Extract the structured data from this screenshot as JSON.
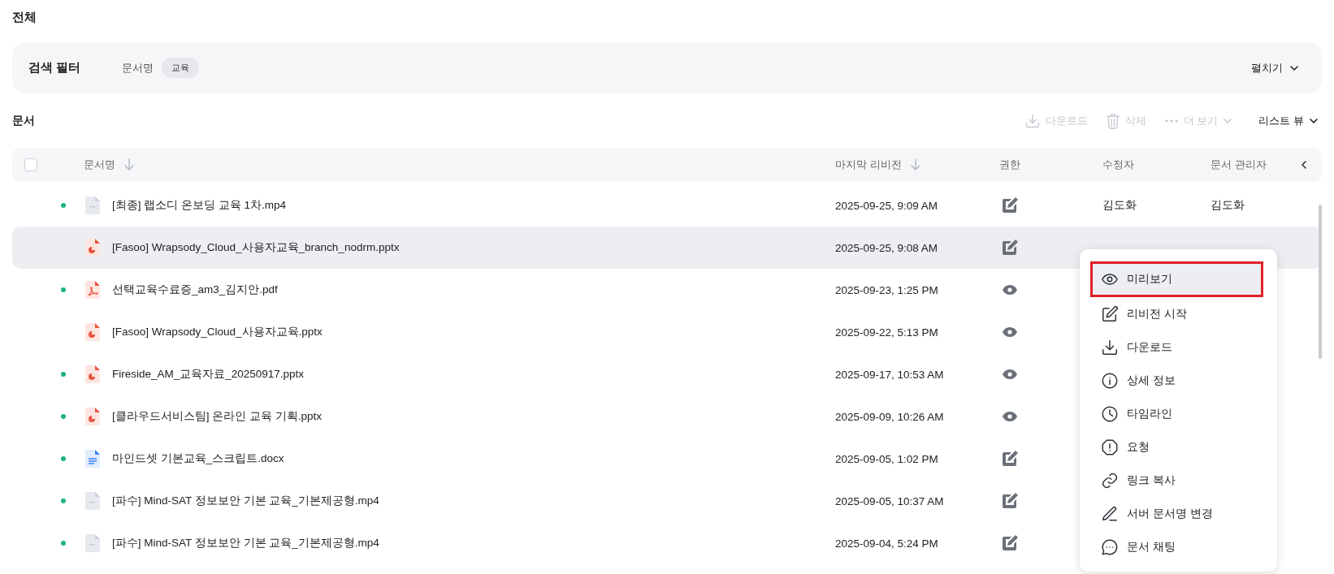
{
  "page_title": "전체",
  "filter": {
    "title": "검색 필터",
    "field_label": "문서명",
    "chip": "교육",
    "expand_label": "펼치기",
    "expanded": false
  },
  "section_title": "문서",
  "toolbar": [
    {
      "kind": "download",
      "label": "다운로드",
      "disabled": true
    },
    {
      "kind": "delete",
      "label": "삭제",
      "disabled": true
    },
    {
      "kind": "more",
      "label": "더 보기",
      "disabled": true
    }
  ],
  "view_switch": {
    "label": "리스트 뷰",
    "expanded": false
  },
  "table": {
    "all_checked": false,
    "columns": [
      {
        "label": "문서명",
        "sortable": true
      },
      {
        "label": "마지막 리비전",
        "sortable": true
      },
      {
        "label": "권한"
      },
      {
        "label": "수정자"
      },
      {
        "label": "문서 관리자"
      }
    ],
    "rows": [
      {
        "unread": true,
        "kind": "video",
        "name": "[최종] 랩소디 온보딩 교육 1차.mp4",
        "revision": "2025-09-25, 9:09 AM",
        "editable": true,
        "editor": "김도화",
        "manager": "김도화",
        "selected": false
      },
      {
        "unread": false,
        "kind": "pptx",
        "name": "[Fasoo] Wrapsody_Cloud_사용자교육_branch_nodrm.pptx",
        "revision": "2025-09-25, 9:08 AM",
        "editable": true,
        "selected": true
      },
      {
        "unread": true,
        "kind": "pdf",
        "name": "선택교육수료증_am3_김지안.pdf",
        "revision": "2025-09-23, 1:25 PM",
        "editable": false,
        "selected": false
      },
      {
        "unread": false,
        "kind": "pptx",
        "name": "[Fasoo] Wrapsody_Cloud_사용자교육.pptx",
        "revision": "2025-09-22, 5:13 PM",
        "editable": false,
        "selected": false
      },
      {
        "unread": true,
        "kind": "pptx",
        "name": "Fireside_AM_교육자료_20250917.pptx",
        "revision": "2025-09-17, 10:53 AM",
        "editable": false,
        "selected": false
      },
      {
        "unread": true,
        "kind": "pptx",
        "name": "[클라우드서비스팀] 온라인 교육 기획.pptx",
        "revision": "2025-09-09, 10:26 AM",
        "editable": false,
        "selected": false
      },
      {
        "unread": true,
        "kind": "docx",
        "name": "마인드셋 기본교육_스크립트.docx",
        "revision": "2025-09-05, 1:02 PM",
        "editable": true,
        "selected": false
      },
      {
        "unread": true,
        "kind": "video",
        "name": "[파수] Mind-SAT 정보보안 기본 교육_기본제공형.mp4",
        "revision": "2025-09-05, 10:37 AM",
        "editable": true,
        "selected": false
      },
      {
        "unread": true,
        "kind": "video",
        "name": "[파수] Mind-SAT 정보보안 기본 교육_기본제공형.mp4",
        "revision": "2025-09-04, 5:24 PM",
        "editable": true,
        "selected": false
      }
    ]
  },
  "context_menu": {
    "items": [
      {
        "kind": "preview",
        "label": "미리보기",
        "selected": true
      },
      {
        "kind": "revise",
        "label": "리비전 시작",
        "selected": false
      },
      {
        "kind": "download",
        "label": "다운로드",
        "selected": false
      },
      {
        "kind": "info",
        "label": "상세 정보",
        "selected": false
      },
      {
        "kind": "timeline",
        "label": "타임라인",
        "selected": false
      },
      {
        "kind": "request",
        "label": "요청",
        "selected": false
      },
      {
        "kind": "link",
        "label": "링크 복사",
        "selected": false
      },
      {
        "kind": "rename",
        "label": "서버 문서명 변경",
        "selected": false
      },
      {
        "kind": "chat",
        "label": "문서 채팅",
        "selected": false
      }
    ]
  }
}
